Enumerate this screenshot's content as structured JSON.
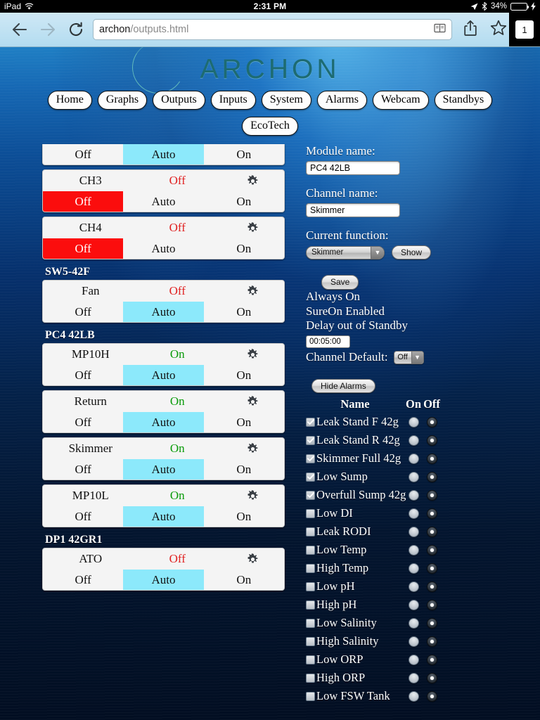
{
  "status_bar": {
    "carrier": "iPad",
    "wifi_icon": "wifi-icon",
    "time": "2:31 PM",
    "location_icon": "location-arrow-icon",
    "bluetooth_icon": "bluetooth-icon",
    "battery_percent": "34%",
    "battery_fill": 34,
    "charging_icon": "lightning-bolt-icon"
  },
  "browser": {
    "back_icon": "back-arrow-icon",
    "forward_icon": "forward-arrow-icon",
    "reload_icon": "reload-icon",
    "url_host": "archon",
    "url_path": "/outputs.html",
    "reader_icon": "reader-view-icon",
    "share_icon": "share-icon",
    "bookmark_icon": "bookmark-star-icon",
    "tab_count": "1"
  },
  "site": {
    "logo_text": "ARCHON",
    "nav_primary": [
      "Home",
      "Graphs",
      "Outputs",
      "Inputs",
      "System",
      "Alarms",
      "Webcam",
      "Standbys"
    ],
    "nav_secondary": [
      "EcoTech"
    ]
  },
  "channels": {
    "groups": [
      {
        "label": "",
        "items": [
          {
            "name": "",
            "state": "",
            "state_class": "",
            "clipped": true,
            "segments": [
              {
                "label": "Off",
                "selected": false,
                "sel_class": ""
              },
              {
                "label": "Auto",
                "selected": true,
                "sel_class": "sel-auto"
              },
              {
                "label": "On",
                "selected": false,
                "sel_class": ""
              }
            ]
          },
          {
            "name": "CH3",
            "state": "Off",
            "state_class": "off",
            "clipped": false,
            "segments": [
              {
                "label": "Off",
                "selected": true,
                "sel_class": "sel-off"
              },
              {
                "label": "Auto",
                "selected": false,
                "sel_class": ""
              },
              {
                "label": "On",
                "selected": false,
                "sel_class": ""
              }
            ]
          },
          {
            "name": "CH4",
            "state": "Off",
            "state_class": "off",
            "clipped": false,
            "segments": [
              {
                "label": "Off",
                "selected": true,
                "sel_class": "sel-off"
              },
              {
                "label": "Auto",
                "selected": false,
                "sel_class": ""
              },
              {
                "label": "On",
                "selected": false,
                "sel_class": ""
              }
            ]
          }
        ]
      },
      {
        "label": "SW5-42F",
        "items": [
          {
            "name": "Fan",
            "state": "Off",
            "state_class": "off",
            "clipped": false,
            "segments": [
              {
                "label": "Off",
                "selected": false,
                "sel_class": ""
              },
              {
                "label": "Auto",
                "selected": true,
                "sel_class": "sel-auto"
              },
              {
                "label": "On",
                "selected": false,
                "sel_class": ""
              }
            ]
          }
        ]
      },
      {
        "label": "PC4 42LB",
        "items": [
          {
            "name": "MP10H",
            "state": "On",
            "state_class": "on",
            "clipped": false,
            "segments": [
              {
                "label": "Off",
                "selected": false,
                "sel_class": ""
              },
              {
                "label": "Auto",
                "selected": true,
                "sel_class": "sel-auto"
              },
              {
                "label": "On",
                "selected": false,
                "sel_class": ""
              }
            ]
          },
          {
            "name": "Return",
            "state": "On",
            "state_class": "on",
            "clipped": false,
            "segments": [
              {
                "label": "Off",
                "selected": false,
                "sel_class": ""
              },
              {
                "label": "Auto",
                "selected": true,
                "sel_class": "sel-auto"
              },
              {
                "label": "On",
                "selected": false,
                "sel_class": ""
              }
            ]
          },
          {
            "name": "Skimmer",
            "state": "On",
            "state_class": "on",
            "clipped": false,
            "segments": [
              {
                "label": "Off",
                "selected": false,
                "sel_class": ""
              },
              {
                "label": "Auto",
                "selected": true,
                "sel_class": "sel-auto"
              },
              {
                "label": "On",
                "selected": false,
                "sel_class": ""
              }
            ]
          },
          {
            "name": "MP10L",
            "state": "On",
            "state_class": "on",
            "clipped": false,
            "segments": [
              {
                "label": "Off",
                "selected": false,
                "sel_class": ""
              },
              {
                "label": "Auto",
                "selected": true,
                "sel_class": "sel-auto"
              },
              {
                "label": "On",
                "selected": false,
                "sel_class": ""
              }
            ]
          }
        ]
      },
      {
        "label": "DP1 42GR1",
        "items": [
          {
            "name": "ATO",
            "state": "Off",
            "state_class": "off",
            "clipped": false,
            "segments": [
              {
                "label": "Off",
                "selected": false,
                "sel_class": ""
              },
              {
                "label": "Auto",
                "selected": true,
                "sel_class": "sel-auto"
              },
              {
                "label": "On",
                "selected": false,
                "sel_class": ""
              }
            ]
          }
        ]
      }
    ],
    "gear_icon": "gear-icon"
  },
  "detail": {
    "module_name_label": "Module name:",
    "module_name_value": "PC4 42LB",
    "channel_name_label": "Channel name:",
    "channel_name_value": "Skimmer",
    "current_function_label": "Current function:",
    "current_function_value": "Skimmer",
    "show_button": "Show",
    "save_button": "Save",
    "always_on": "Always On",
    "sure_on": "SureOn Enabled",
    "delay_label": "Delay out of Standby",
    "delay_value": "00:05:00",
    "channel_default_label": "Channel Default:",
    "channel_default_value": "Off",
    "hide_alarms_button": "Hide Alarms"
  },
  "alarms": {
    "header": {
      "name": "Name",
      "on": "On",
      "off": "Off"
    },
    "rows": [
      {
        "label": "Leak Stand F 42g",
        "checked": true,
        "on_selected": false,
        "off_selected": true
      },
      {
        "label": "Leak Stand R 42g",
        "checked": true,
        "on_selected": false,
        "off_selected": true
      },
      {
        "label": "Skimmer Full 42g",
        "checked": true,
        "on_selected": false,
        "off_selected": true
      },
      {
        "label": "Low Sump",
        "checked": true,
        "on_selected": false,
        "off_selected": true
      },
      {
        "label": "Overfull Sump 42g",
        "checked": true,
        "on_selected": false,
        "off_selected": true
      },
      {
        "label": "Low DI",
        "checked": false,
        "on_selected": false,
        "off_selected": true
      },
      {
        "label": "Leak RODI",
        "checked": false,
        "on_selected": false,
        "off_selected": true
      },
      {
        "label": "Low Temp",
        "checked": false,
        "on_selected": false,
        "off_selected": true
      },
      {
        "label": "High Temp",
        "checked": false,
        "on_selected": false,
        "off_selected": true
      },
      {
        "label": "Low pH",
        "checked": false,
        "on_selected": false,
        "off_selected": true
      },
      {
        "label": "High pH",
        "checked": false,
        "on_selected": false,
        "off_selected": true
      },
      {
        "label": "Low Salinity",
        "checked": false,
        "on_selected": false,
        "off_selected": true
      },
      {
        "label": "High Salinity",
        "checked": false,
        "on_selected": false,
        "off_selected": true
      },
      {
        "label": "Low ORP",
        "checked": false,
        "on_selected": false,
        "off_selected": true
      },
      {
        "label": "High ORP",
        "checked": false,
        "on_selected": false,
        "off_selected": true
      },
      {
        "label": "Low FSW Tank",
        "checked": false,
        "on_selected": false,
        "off_selected": true
      }
    ]
  },
  "colors": {
    "selected_auto": "#8ce9fb",
    "selected_off": "#fb0d0d",
    "state_on": "#0a9b0a",
    "state_off": "#e02020",
    "battery_green": "#4cd964"
  }
}
